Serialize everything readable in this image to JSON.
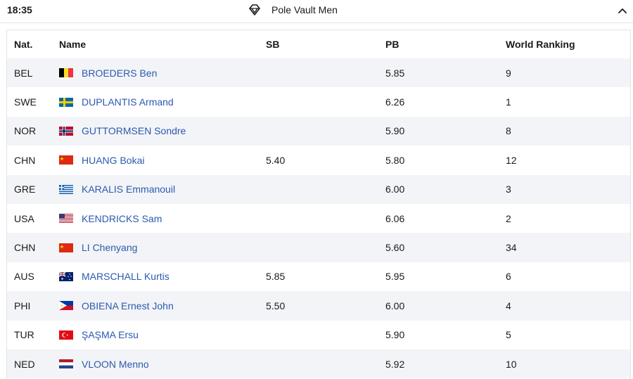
{
  "header": {
    "time": "18:35",
    "title": "Pole Vault Men",
    "event_icon": "diamond-icon",
    "collapse_icon": "chevron-up-icon"
  },
  "table": {
    "columns": {
      "nat": "Nat.",
      "name": "Name",
      "sb": "SB",
      "pb": "PB",
      "rank": "World Ranking"
    },
    "rows": [
      {
        "nat": "BEL",
        "flag": "flag-belgium",
        "name": "BROEDERS Ben",
        "sb": "",
        "pb": "5.85",
        "rank": "9"
      },
      {
        "nat": "SWE",
        "flag": "flag-sweden",
        "name": "DUPLANTIS Armand",
        "sb": "",
        "pb": "6.26",
        "rank": "1"
      },
      {
        "nat": "NOR",
        "flag": "flag-norway",
        "name": "GUTTORMSEN Sondre",
        "sb": "",
        "pb": "5.90",
        "rank": "8"
      },
      {
        "nat": "CHN",
        "flag": "flag-china",
        "name": "HUANG Bokai",
        "sb": "5.40",
        "pb": "5.80",
        "rank": "12"
      },
      {
        "nat": "GRE",
        "flag": "flag-greece",
        "name": "KARALIS Emmanouil",
        "sb": "",
        "pb": "6.00",
        "rank": "3"
      },
      {
        "nat": "USA",
        "flag": "flag-usa",
        "name": "KENDRICKS Sam",
        "sb": "",
        "pb": "6.06",
        "rank": "2"
      },
      {
        "nat": "CHN",
        "flag": "flag-china",
        "name": "LI Chenyang",
        "sb": "",
        "pb": "5.60",
        "rank": "34"
      },
      {
        "nat": "AUS",
        "flag": "flag-australia",
        "name": "MARSCHALL Kurtis",
        "sb": "5.85",
        "pb": "5.95",
        "rank": "6"
      },
      {
        "nat": "PHI",
        "flag": "flag-philippines",
        "name": "OBIENA Ernest John",
        "sb": "5.50",
        "pb": "6.00",
        "rank": "4"
      },
      {
        "nat": "TUR",
        "flag": "flag-turkey",
        "name": "ŞAŞMA Ersu",
        "sb": "",
        "pb": "5.90",
        "rank": "5"
      },
      {
        "nat": "NED",
        "flag": "flag-netherlands",
        "name": "VLOON Menno",
        "sb": "",
        "pb": "5.92",
        "rank": "10"
      }
    ]
  },
  "colors": {
    "link": "#2a5ab0",
    "row_shade": "#f3f4f7",
    "border": "#e1e4ea",
    "text": "#1a1a1a"
  }
}
